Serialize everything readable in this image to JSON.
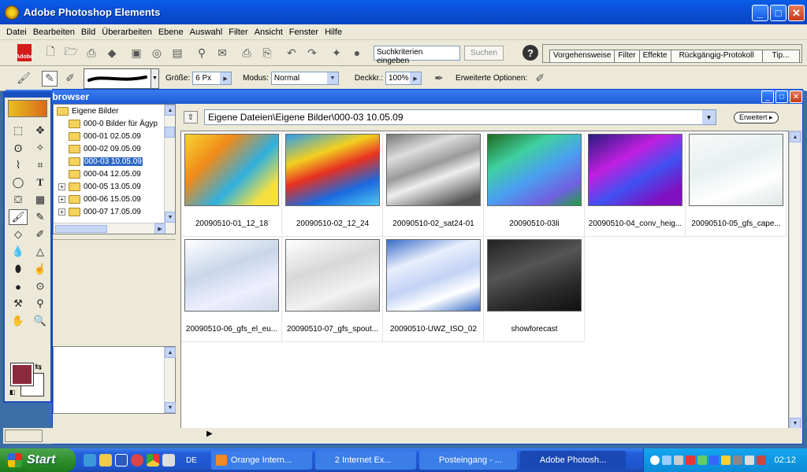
{
  "app": {
    "title": "Adobe Photoshop Elements"
  },
  "menu": [
    "Datei",
    "Bearbeiten",
    "Bild",
    "Überarbeiten",
    "Ebene",
    "Auswahl",
    "Filter",
    "Ansicht",
    "Fenster",
    "Hilfe"
  ],
  "toolbar": {
    "adobe_label": "Adobe",
    "search_value": "Suchkriterien eingeben",
    "search_button": "Suchen",
    "help_glyph": "?",
    "palette_tabs": [
      "Vorgehensweise",
      "Filter",
      "Effekte",
      "Rückgängig-Protokoll",
      "Tip..."
    ]
  },
  "options": {
    "size_label": "Größe:",
    "size_value": "6 Px",
    "mode_label": "Modus:",
    "mode_value": "Normal",
    "opacity_label": "Deckkr.:",
    "opacity_value": "100%",
    "advanced_label": "Erweiterte Optionen:"
  },
  "filebrowser": {
    "title": "Dateibrowser",
    "path": "Eigene Dateien\\Eigene Bilder\\000-03 10.05.09",
    "advanced_button": "Erweitert ▸",
    "tree": [
      {
        "label": "Eigene Bilder",
        "expand": "",
        "selected": false
      },
      {
        "label": "000-0 Bilder für Ägyp",
        "expand": "",
        "selected": false
      },
      {
        "label": "000-01 02.05.09",
        "expand": "",
        "selected": false
      },
      {
        "label": "000-02 09.05.09",
        "expand": "",
        "selected": false
      },
      {
        "label": "000-03 10.05.09",
        "expand": "",
        "selected": true
      },
      {
        "label": "000-04 12.05.09",
        "expand": "",
        "selected": false
      },
      {
        "label": "000-05 13.05.09",
        "expand": "+",
        "selected": false
      },
      {
        "label": "000-06 15.05.09",
        "expand": "+",
        "selected": false
      },
      {
        "label": "000-07 17.05.09",
        "expand": "+",
        "selected": false
      }
    ],
    "thumbnails": [
      {
        "caption": "20090510-01_12_18",
        "style": "heat"
      },
      {
        "caption": "20090510-02_12_24",
        "style": "heat2"
      },
      {
        "caption": "20090510-02_sat24-01",
        "style": "sat"
      },
      {
        "caption": "20090510-03li",
        "style": "green"
      },
      {
        "caption": "20090510-04_conv_heig...",
        "style": "purple"
      },
      {
        "caption": "20090510-05_gfs_cape...",
        "style": "light"
      },
      {
        "caption": "20090510-06_gfs_el_eu...",
        "style": "pale"
      },
      {
        "caption": "20090510-07_gfs_spout...",
        "style": "grey"
      },
      {
        "caption": "20090510-UWZ_ISO_02",
        "style": "uwz"
      },
      {
        "caption": "showforecast",
        "style": "dark"
      }
    ]
  },
  "taskbar": {
    "start": "Start",
    "lang": "DE",
    "tasks": [
      {
        "label": "Orange Intern...",
        "color": "#f08a24"
      },
      {
        "label": "2 Internet Ex...",
        "color": "#3c7ee8"
      },
      {
        "label": "Posteingang - ...",
        "color": "#3c7ee8"
      },
      {
        "label": "Adobe Photosh...",
        "color": "#1a49b5"
      }
    ],
    "clock": "02:12"
  },
  "colors": {
    "foreground": "#8a2a3a",
    "background": "#ffffff"
  }
}
